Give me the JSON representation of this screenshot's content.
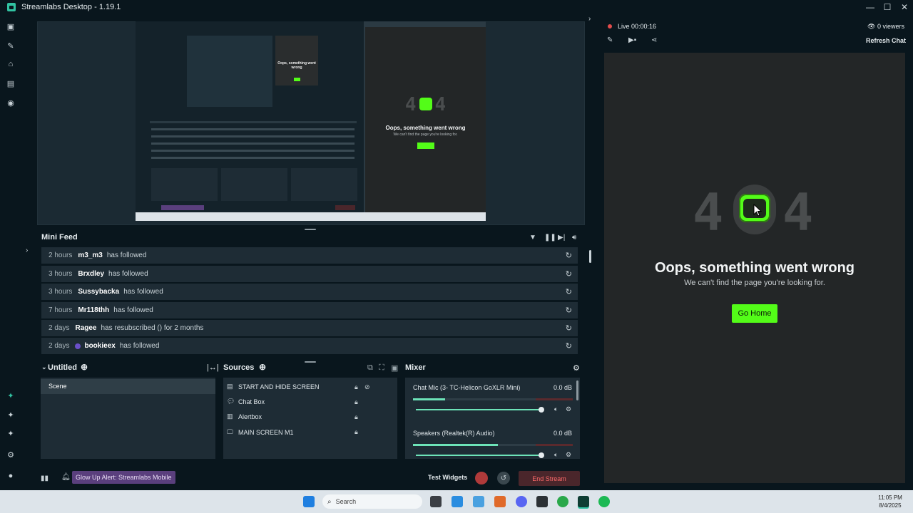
{
  "window": {
    "title": "Streamlabs Desktop - 1.19.1",
    "controls": [
      "—",
      "☐",
      "✕"
    ]
  },
  "mini_feed": {
    "title": "Mini Feed",
    "rows": [
      {
        "time": "2 hours",
        "user": "m3_m3",
        "msg": "has followed"
      },
      {
        "time": "3 hours",
        "user": "Brxdley",
        "msg": "has followed"
      },
      {
        "time": "3 hours",
        "user": "Sussybacka",
        "msg": "has followed"
      },
      {
        "time": "7 hours",
        "user": "Mr118thh",
        "msg": "has followed"
      },
      {
        "time": "2 days",
        "user": "Ragee",
        "msg": "has resubscribed () for 2 months"
      },
      {
        "time": "2 days",
        "user": "bookieex",
        "msg": "has followed"
      }
    ]
  },
  "scenes": {
    "title": "Untitled",
    "items": [
      "Scene"
    ]
  },
  "sources": {
    "title": "Sources",
    "items": [
      "START AND HIDE SCREEN",
      "Chat Box",
      "Alertbox",
      "MAIN SCREEN M1"
    ]
  },
  "mixer": {
    "title": "Mixer",
    "channels": [
      {
        "name": "Chat Mic (3- TC-Helicon GoXLR Mini)",
        "db": "0.0 dB",
        "level": 0.2
      },
      {
        "name": "Speakers (Realtek(R) Audio)",
        "db": "0.0 dB",
        "level": 0.53
      }
    ]
  },
  "footer": {
    "alert": "Glow Up Alert: Streamlabs Mobile",
    "test_widgets": "Test Widgets",
    "end_stream": "End Stream"
  },
  "chat": {
    "live_label": "Live",
    "live_time": "00:00:16",
    "viewers": "0 viewers",
    "refresh": "Refresh Chat",
    "error_code_left": "4",
    "error_code_right": "4",
    "error_title": "Oops, something went wrong",
    "error_sub": "We can't find the page you're looking for.",
    "go_home": "Go Home"
  },
  "taskbar": {
    "search_placeholder": "Search",
    "time": "11:05 PM",
    "date": "8/4/2025"
  },
  "colors": {
    "accent": "#31c3a2",
    "kick_green": "#53fc18",
    "end_stream": "#ff6b6b"
  }
}
